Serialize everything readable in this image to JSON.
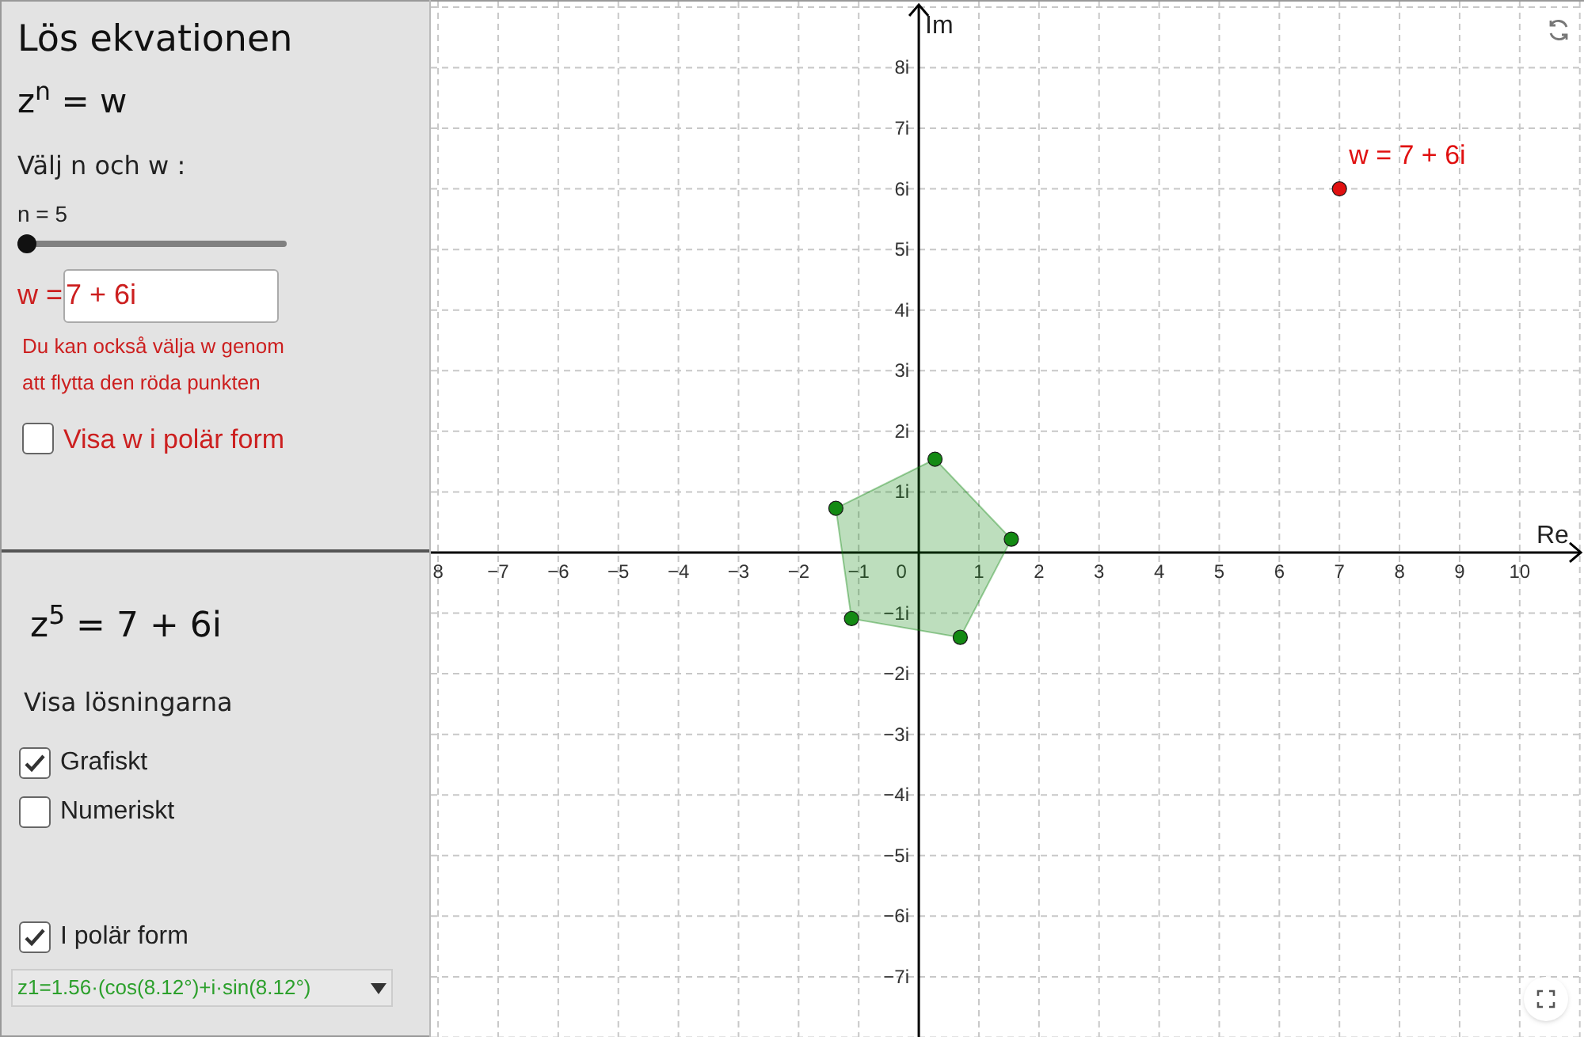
{
  "top_panel": {
    "title": "Lös ekvationen",
    "equation": "z$^{n}$ = w",
    "prompt": "Välj n och w :",
    "slider": {
      "label": "n = 5",
      "level": 0
    },
    "w_field": {
      "label": "w =",
      "value": "7 + 6i"
    },
    "hint": "Du kan också välja w genom\natt flytta den röda punkten",
    "polar_checkbox": {
      "label": "Visa w i polär form",
      "checked": false
    }
  },
  "bottom_panel": {
    "equation": "z$^{5}$ = 7 + 6i",
    "heading": "Visa lösningarna",
    "checkboxes": [
      {
        "label": "Grafiskt",
        "checked": true
      },
      {
        "label": "Numeriskt",
        "checked": false
      }
    ],
    "polar_checkbox": {
      "label": "I polär form",
      "checked": true
    },
    "solution_dropdown": {
      "value": "z1=1.56·(cos(8.12°)+i·sin(8.12°)"
    }
  },
  "graphics": {
    "chart_data": {
      "type": "scatter",
      "grid": true,
      "xlabel": "Re",
      "ylabel": "Im",
      "xlim": [
        -8.12,
        11.07
      ],
      "ylim": [
        -8.02,
        9.09
      ],
      "xticks": [
        {
          "value": -8,
          "label": "8"
        },
        {
          "value": -7,
          "label": "−7"
        },
        {
          "value": -6,
          "label": "−6"
        },
        {
          "value": -5,
          "label": "−5"
        },
        {
          "value": -4,
          "label": "−4"
        },
        {
          "value": -3,
          "label": "−3"
        },
        {
          "value": -2,
          "label": "−2"
        },
        {
          "value": -1,
          "label": "−1"
        },
        {
          "value": 1,
          "label": "1"
        },
        {
          "value": 2,
          "label": "2"
        },
        {
          "value": 3,
          "label": "3"
        },
        {
          "value": 4,
          "label": "4"
        },
        {
          "value": 5,
          "label": "5"
        },
        {
          "value": 6,
          "label": "6"
        },
        {
          "value": 7,
          "label": "7"
        },
        {
          "value": 8,
          "label": "8"
        },
        {
          "value": 9,
          "label": "9"
        },
        {
          "value": 10,
          "label": "10"
        }
      ],
      "yticks": [
        {
          "value": 8,
          "label": "8i"
        },
        {
          "value": 7,
          "label": "7i"
        },
        {
          "value": 6,
          "label": "6i"
        },
        {
          "value": 5,
          "label": "5i"
        },
        {
          "value": 4,
          "label": "4i"
        },
        {
          "value": 3,
          "label": "3i"
        },
        {
          "value": 2,
          "label": "2i"
        },
        {
          "value": 1,
          "label": "1i"
        },
        {
          "value": -1,
          "label": "−1i"
        },
        {
          "value": -2,
          "label": "−2i"
        },
        {
          "value": -3,
          "label": "−3i"
        },
        {
          "value": -4,
          "label": "−4i"
        },
        {
          "value": -5,
          "label": "−5i"
        },
        {
          "value": -6,
          "label": "−6i"
        },
        {
          "value": -7,
          "label": "−7i"
        }
      ],
      "series": [
        {
          "color": "#138a13",
          "x": [
            1.54,
            0.27,
            -1.38,
            -1.12,
            0.69
          ],
          "values": [
            0.22,
            1.54,
            0.73,
            -1.09,
            -1.4
          ]
        },
        {
          "color": "#e01010",
          "x": [
            7
          ],
          "values": [
            6
          ]
        }
      ],
      "annotations": [
        "w = 7 + 6i"
      ]
    },
    "origin_label": "0"
  }
}
